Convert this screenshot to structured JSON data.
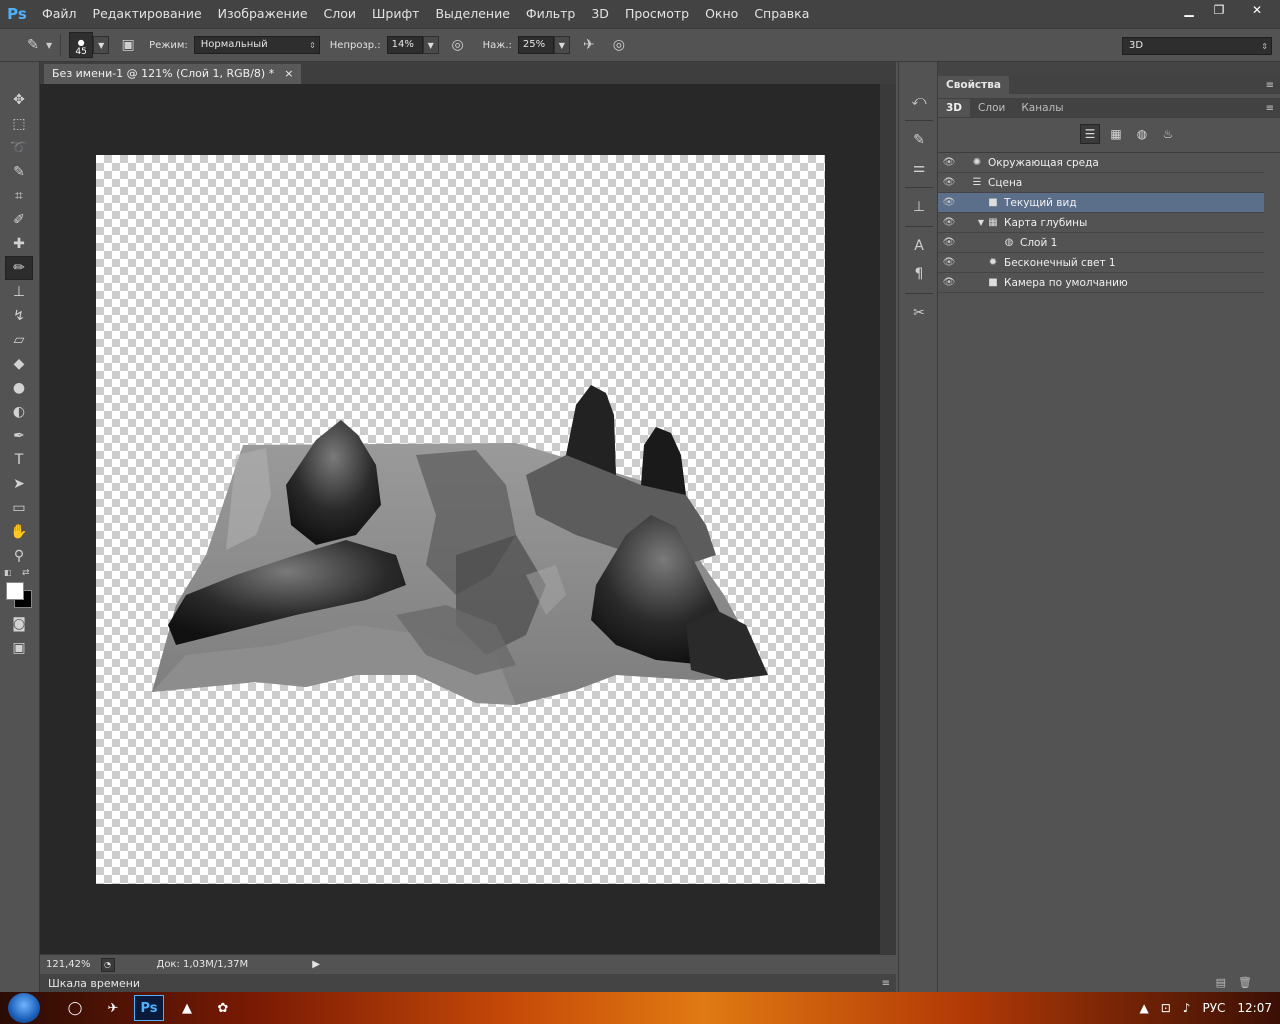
{
  "app": {
    "logo": "Ps"
  },
  "menu": [
    "Файл",
    "Редактирование",
    "Изображение",
    "Слои",
    "Шрифт",
    "Выделение",
    "Фильтр",
    "3D",
    "Просмотр",
    "Окно",
    "Справка"
  ],
  "options": {
    "brush_size": "45",
    "mode_label": "Режим:",
    "mode_value": "Нормальный",
    "opacity_label": "Непрозр.:",
    "opacity_value": "14%",
    "flow_label": "Наж.:",
    "flow_value": "25%",
    "workspace": "3D"
  },
  "document": {
    "tab_title": "Без имени-1 @ 121% (Слой 1, RGB/8) *",
    "close": "×"
  },
  "status": {
    "zoom": "121,42%",
    "doc_info": "Док: 1,03M/1,37M"
  },
  "timeline": {
    "label": "Шкала времени"
  },
  "properties": {
    "title": "Свойства",
    "tabs": [
      "3D",
      "Слои",
      "Каналы"
    ],
    "scene_items": [
      {
        "label": "Окружающая среда",
        "icon": "environment-icon",
        "indent": 0,
        "selected": false,
        "expander": ""
      },
      {
        "label": "Сцена",
        "icon": "scene-icon",
        "indent": 0,
        "selected": false,
        "expander": ""
      },
      {
        "label": "Текущий вид",
        "icon": "camera-icon",
        "indent": 1,
        "selected": true,
        "expander": ""
      },
      {
        "label": "Карта глубины",
        "icon": "mesh-icon",
        "indent": 1,
        "selected": false,
        "expander": "▼"
      },
      {
        "label": "Слой 1",
        "icon": "material-icon",
        "indent": 2,
        "selected": false,
        "expander": ""
      },
      {
        "label": "Бесконечный свет 1",
        "icon": "light-icon",
        "indent": 1,
        "selected": false,
        "expander": ""
      },
      {
        "label": "Камера по умолчанию",
        "icon": "camera-icon",
        "indent": 1,
        "selected": false,
        "expander": ""
      }
    ]
  },
  "taskbar": {
    "lang": "РУС",
    "time": "12:07"
  },
  "colors": {
    "selection": "#5b6f8a",
    "canvas_bg": "#282828",
    "panel_bg": "#535353"
  }
}
